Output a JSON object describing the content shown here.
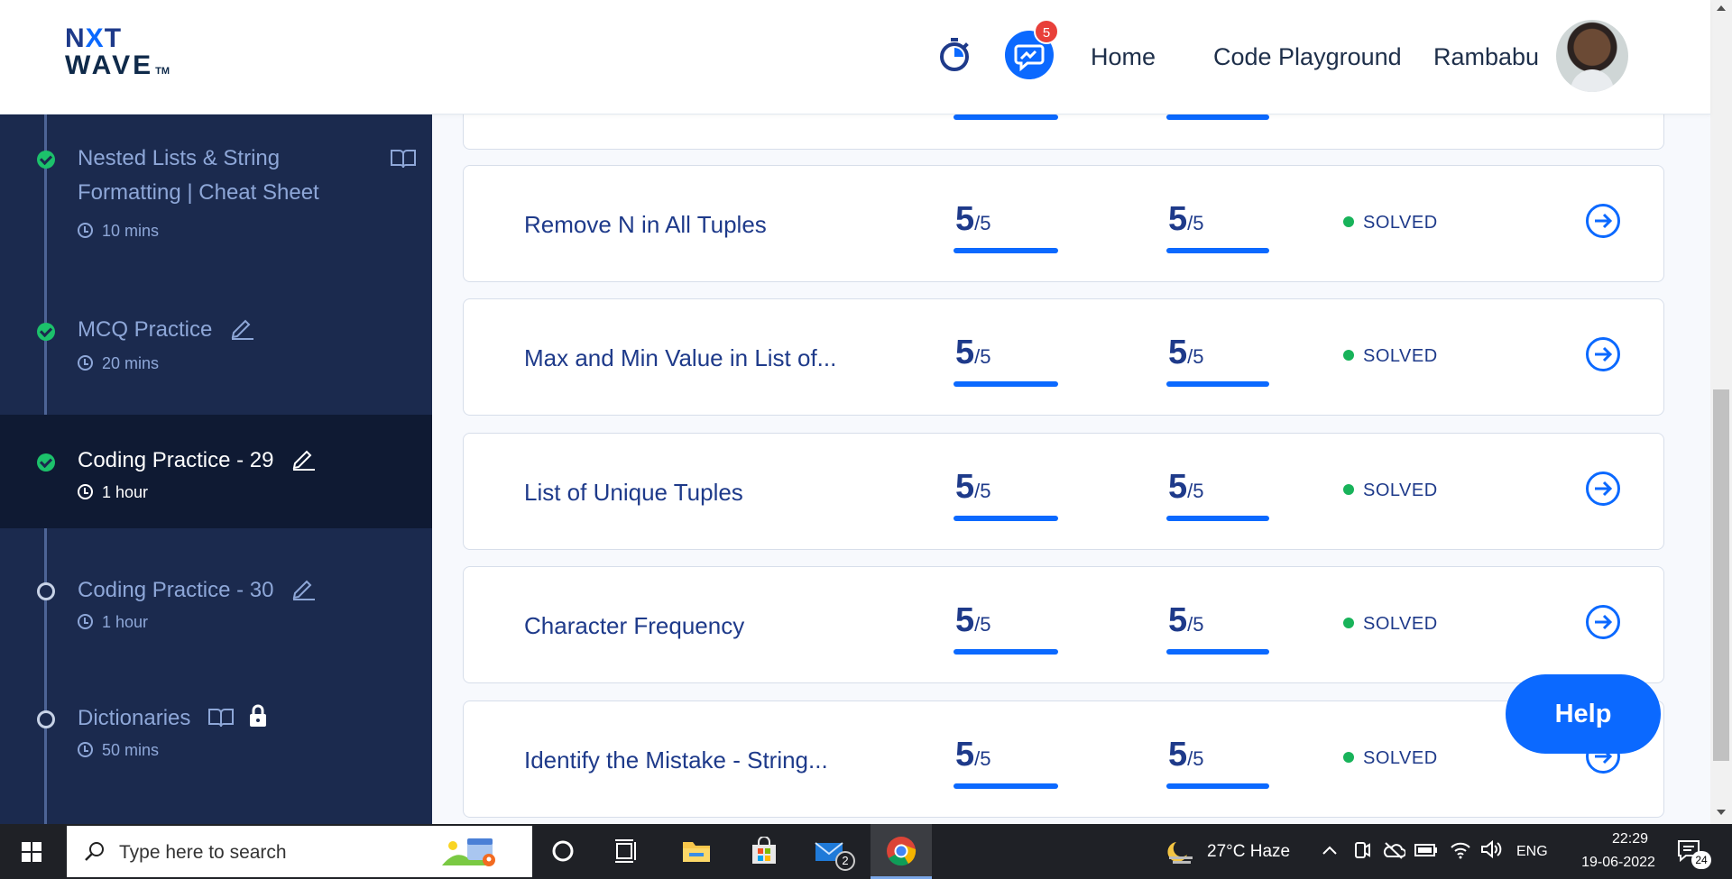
{
  "header": {
    "logo_line1_a": "N",
    "logo_line1_x": "X",
    "logo_line1_b": "T",
    "logo_line2": "WAVE",
    "logo_tm": "TM",
    "chat_badge": "5",
    "nav_home": "Home",
    "nav_code_playground": "Code Playground",
    "user_name": "Rambabu"
  },
  "sidebar": {
    "items": [
      {
        "title_line1": "Nested Lists & String",
        "title_line2": "Formatting | Cheat Sheet",
        "duration": "10 mins",
        "status": "done"
      },
      {
        "title": "MCQ Practice",
        "duration": "20 mins",
        "status": "done"
      },
      {
        "title": "Coding Practice - 29",
        "duration": "1 hour",
        "status": "done",
        "active": true
      },
      {
        "title": "Coding Practice - 30",
        "duration": "1 hour",
        "status": "open"
      },
      {
        "title": "Dictionaries",
        "duration": "50 mins",
        "status": "open",
        "locked": true
      }
    ]
  },
  "questions": [
    {
      "name": "Remove N in All Tuples",
      "score1": "5",
      "total1": "/5",
      "score2": "5",
      "total2": "/5",
      "status": "SOLVED"
    },
    {
      "name": "Max and Min Value in List of...",
      "score1": "5",
      "total1": "/5",
      "score2": "5",
      "total2": "/5",
      "status": "SOLVED"
    },
    {
      "name": "List of Unique Tuples",
      "score1": "5",
      "total1": "/5",
      "score2": "5",
      "total2": "/5",
      "status": "SOLVED"
    },
    {
      "name": "Character Frequency",
      "score1": "5",
      "total1": "/5",
      "score2": "5",
      "total2": "/5",
      "status": "SOLVED"
    },
    {
      "name": "Identify the Mistake - String...",
      "score1": "5",
      "total1": "/5",
      "score2": "5",
      "total2": "/5",
      "status": "SOLVED"
    }
  ],
  "help_label": "Help",
  "taskbar": {
    "search_placeholder": "Type here to search",
    "mail_badge": "2",
    "weather": "27°C  Haze",
    "language": "ENG",
    "time": "22:29",
    "date": "19-06-2022",
    "notification_count": "24"
  },
  "colors": {
    "sidebar_bg": "#1b2a4e",
    "accent_blue": "#0b69ff",
    "solved_green": "#18b35a",
    "text_navy": "#1e3a8a"
  }
}
